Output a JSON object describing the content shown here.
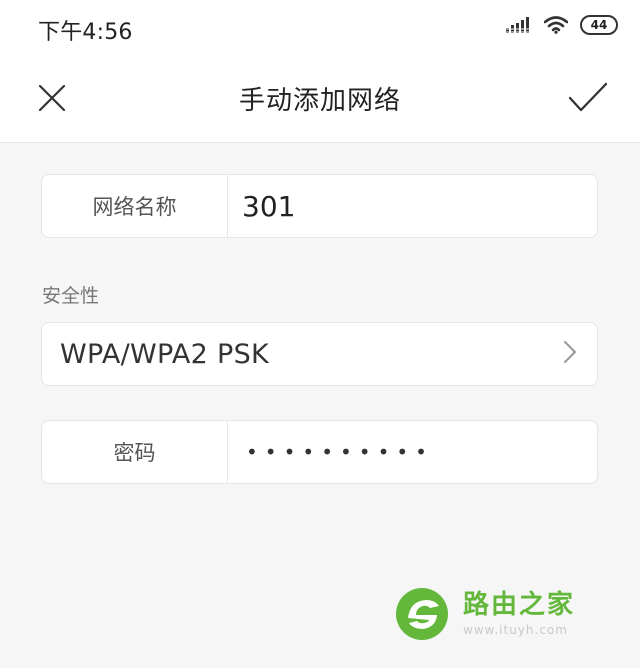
{
  "status_bar": {
    "time": "下午4:56",
    "battery": "44",
    "icons": [
      "signal-icon",
      "wifi-icon",
      "battery-icon"
    ]
  },
  "header": {
    "title": "手动添加网络",
    "close_icon": "close-icon",
    "confirm_icon": "check-icon"
  },
  "form": {
    "network_name": {
      "label": "网络名称",
      "value": "301"
    },
    "security": {
      "section_label": "安全性",
      "value": "WPA/WPA2 PSK",
      "chevron_icon": "chevron-right-icon"
    },
    "password": {
      "label": "密码",
      "masked_value": "••••••••••"
    }
  },
  "watermark": {
    "title": "路由之家",
    "subtitle": "www.ituyh.com"
  },
  "colors": {
    "background": "#f6f6f6",
    "card": "#ffffff",
    "border": "#e6e6e6",
    "text_primary": "#222222",
    "text_secondary": "#777777",
    "watermark_green": "#5cb531"
  }
}
